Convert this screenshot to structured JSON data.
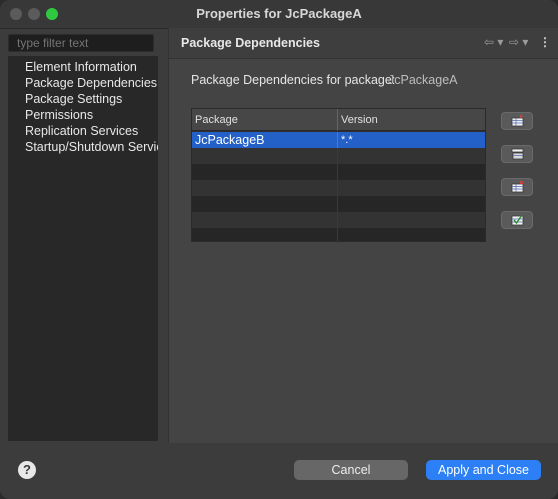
{
  "window": {
    "title": "Properties for JcPackageA"
  },
  "sidebar": {
    "filter_placeholder": "type filter text",
    "items": [
      {
        "label": "Element Information"
      },
      {
        "label": "Package Dependencies"
      },
      {
        "label": "Package Settings"
      },
      {
        "label": "Permissions"
      },
      {
        "label": "Replication Services"
      },
      {
        "label": "Startup/Shutdown Servic"
      }
    ]
  },
  "page": {
    "title": "Package Dependencies",
    "dependencies_label": "Package Dependencies for package:",
    "package_name": "JcPackageA",
    "nav": {
      "back": "⇦ ▾",
      "forward": "⇨ ▾",
      "menu": "⋮"
    }
  },
  "table": {
    "columns": [
      "Package",
      "Version"
    ],
    "rows": [
      {
        "package": "JcPackageB",
        "version": "*.*"
      }
    ]
  },
  "side_buttons": [
    {
      "icon": "add-dependency-icon"
    },
    {
      "icon": "edit-dependency-icon"
    },
    {
      "icon": "remove-dependency-icon"
    },
    {
      "icon": "validate-dependency-icon"
    }
  ],
  "footer": {
    "help": "?",
    "cancel_label": "Cancel",
    "apply_label": "Apply and Close"
  },
  "colors": {
    "accent": "#2c7ff5",
    "selection": "#2360c8",
    "maximize": "#2fc840"
  }
}
